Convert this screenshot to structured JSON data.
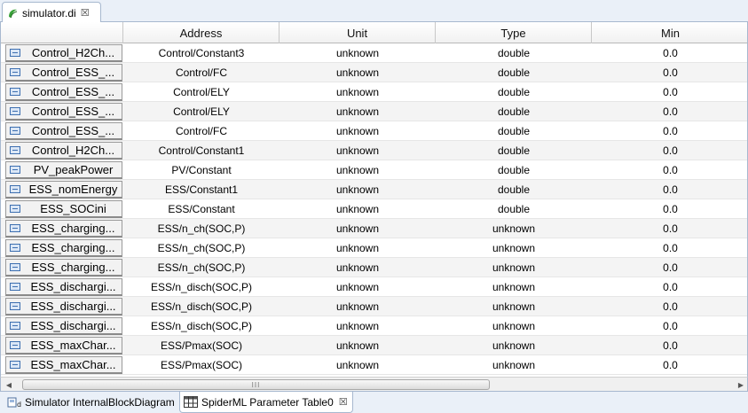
{
  "editor_tab": {
    "label": "simulator.di",
    "close": "☒"
  },
  "columns": [
    {
      "label": "",
      "key": "name"
    },
    {
      "label": "Address",
      "key": "address"
    },
    {
      "label": "Unit",
      "key": "unit"
    },
    {
      "label": "Type",
      "key": "type"
    },
    {
      "label": "Min",
      "key": "min"
    }
  ],
  "rows": [
    {
      "name": "Control_H2Ch...",
      "address": "Control/Constant3",
      "unit": "unknown",
      "type": "double",
      "min": "0.0"
    },
    {
      "name": "Control_ESS_...",
      "address": "Control/FC",
      "unit": "unknown",
      "type": "double",
      "min": "0.0"
    },
    {
      "name": "Control_ESS_...",
      "address": "Control/ELY",
      "unit": "unknown",
      "type": "double",
      "min": "0.0"
    },
    {
      "name": "Control_ESS_...",
      "address": "Control/ELY",
      "unit": "unknown",
      "type": "double",
      "min": "0.0"
    },
    {
      "name": "Control_ESS_...",
      "address": "Control/FC",
      "unit": "unknown",
      "type": "double",
      "min": "0.0"
    },
    {
      "name": "Control_H2Ch...",
      "address": "Control/Constant1",
      "unit": "unknown",
      "type": "double",
      "min": "0.0"
    },
    {
      "name": "PV_peakPower",
      "address": "PV/Constant",
      "unit": "unknown",
      "type": "double",
      "min": "0.0"
    },
    {
      "name": "ESS_nomEnergy",
      "address": "ESS/Constant1",
      "unit": "unknown",
      "type": "double",
      "min": "0.0"
    },
    {
      "name": "ESS_SOCini",
      "address": "ESS/Constant",
      "unit": "unknown",
      "type": "double",
      "min": "0.0"
    },
    {
      "name": "ESS_charging...",
      "address": "ESS/n_ch(SOC,P)",
      "unit": "unknown",
      "type": "unknown",
      "min": "0.0"
    },
    {
      "name": "ESS_charging...",
      "address": "ESS/n_ch(SOC,P)",
      "unit": "unknown",
      "type": "unknown",
      "min": "0.0"
    },
    {
      "name": "ESS_charging...",
      "address": "ESS/n_ch(SOC,P)",
      "unit": "unknown",
      "type": "unknown",
      "min": "0.0"
    },
    {
      "name": "ESS_dischargi...",
      "address": "ESS/n_disch(SOC,P)",
      "unit": "unknown",
      "type": "unknown",
      "min": "0.0"
    },
    {
      "name": "ESS_dischargi...",
      "address": "ESS/n_disch(SOC,P)",
      "unit": "unknown",
      "type": "unknown",
      "min": "0.0"
    },
    {
      "name": "ESS_dischargi...",
      "address": "ESS/n_disch(SOC,P)",
      "unit": "unknown",
      "type": "unknown",
      "min": "0.0"
    },
    {
      "name": "ESS_maxChar...",
      "address": "ESS/Pmax(SOC)",
      "unit": "unknown",
      "type": "unknown",
      "min": "0.0"
    },
    {
      "name": "ESS_maxChar...",
      "address": "ESS/Pmax(SOC)",
      "unit": "unknown",
      "type": "unknown",
      "min": "0.0"
    }
  ],
  "scrollbar": {
    "grip": "III"
  },
  "bottom_tabs": [
    {
      "label": "Simulator InternalBlockDiagram",
      "icon": "ibd-diagram-icon"
    },
    {
      "label": "SpiderML Parameter Table0",
      "icon": "table-icon",
      "close": "☒"
    }
  ]
}
